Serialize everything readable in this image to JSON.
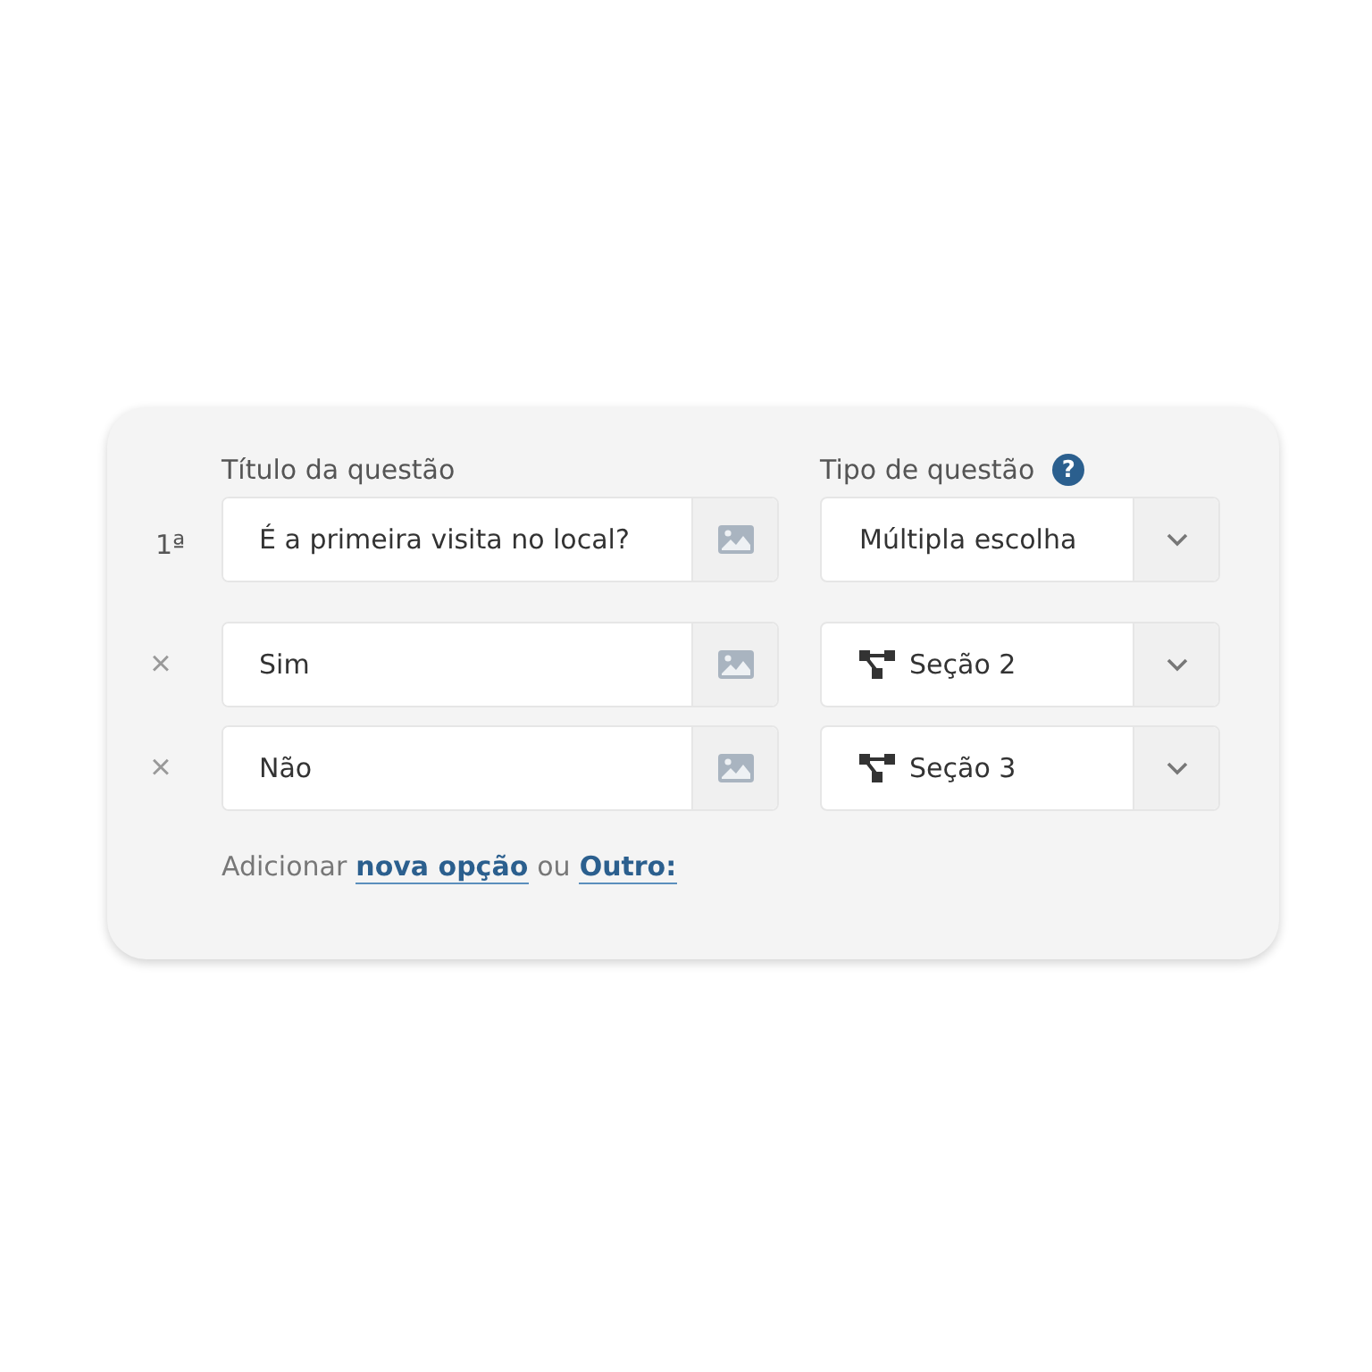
{
  "headers": {
    "title": "Título da questão",
    "type": "Tipo de questão",
    "help": "?"
  },
  "question": {
    "number": "1ª",
    "title": "É a primeira visita no local?",
    "type": "Múltipla escolha"
  },
  "options": [
    {
      "remove": "×",
      "text": "Sim",
      "section": "Seção 2"
    },
    {
      "remove": "×",
      "text": "Não",
      "section": "Seção 3"
    }
  ],
  "footer": {
    "prefix": "Adicionar",
    "link1": "nova opção",
    "middle": "ou",
    "link2": "Outro:"
  }
}
